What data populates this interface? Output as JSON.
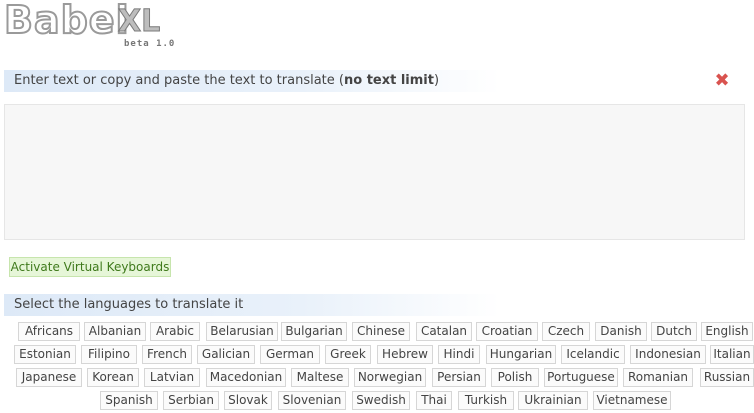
{
  "logo": {
    "main": "Babel",
    "xl": "XL",
    "beta": "beta 1.0"
  },
  "input_section": {
    "heading_prefix": "Enter text or copy and paste the text to translate (",
    "heading_bold": "no text limit",
    "heading_suffix": ")",
    "close_icon": "close-icon",
    "text_value": "",
    "keyboard_button": "Activate Virtual Keyboards"
  },
  "languages_section": {
    "heading": "Select the languages to translate it",
    "rows": [
      [
        "Africans",
        "Albanian",
        "Arabic",
        "Belarusian",
        "Bulgarian",
        "Chinese",
        "Catalan",
        "Croatian",
        "Czech",
        "Danish",
        "Dutch",
        "English"
      ],
      [
        "Estonian",
        "Filipino",
        "French",
        "Galician",
        "German",
        "Greek",
        "Hebrew",
        "Hindi",
        "Hungarian",
        "Icelandic",
        "Indonesian",
        "Italian"
      ],
      [
        "Japanese",
        "Korean",
        "Latvian",
        "Macedonian",
        "Maltese",
        "Norwegian",
        "Persian",
        "Polish",
        "Portuguese",
        "Romanian",
        "Russian"
      ],
      [
        "Spanish",
        "Serbian",
        "Slovak",
        "Slovenian",
        "Swedish",
        "Thai",
        "Turkish",
        "Ukrainian",
        "Vietnamese"
      ]
    ]
  },
  "colors": {
    "accent_red": "#d9534f",
    "keyboard_green": "#e6f6d8",
    "bar_blue": "#dde9f7"
  }
}
